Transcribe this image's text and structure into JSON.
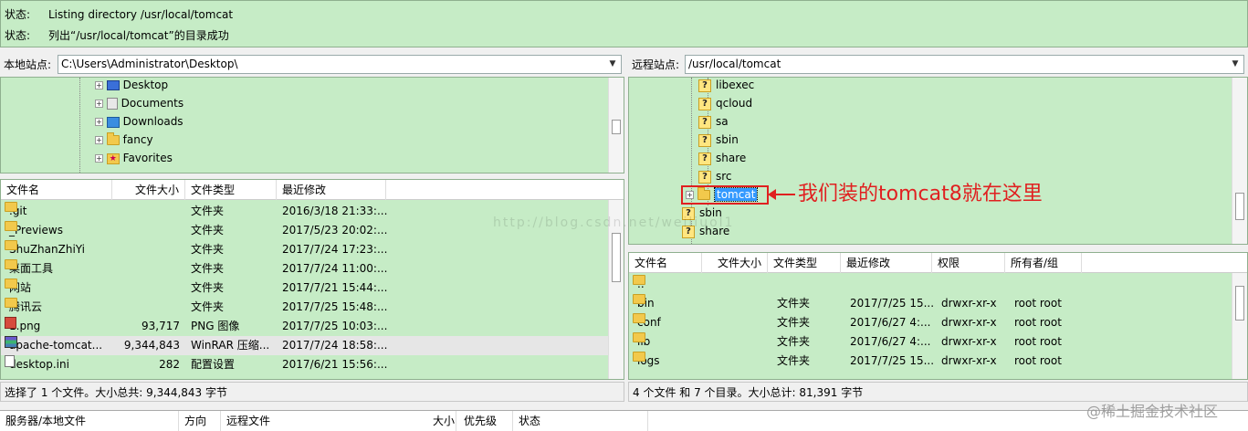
{
  "status_log": [
    {
      "key": "状态:",
      "text": "Listing directory /usr/local/tomcat"
    },
    {
      "key": "状态:",
      "text": "列出“/usr/local/tomcat”的目录成功"
    }
  ],
  "local": {
    "site_label": "本地站点:",
    "path": "C:\\Users\\Administrator\\Desktop\\",
    "tree": [
      {
        "label": "Desktop",
        "icon": "desktop-icon"
      },
      {
        "label": "Documents",
        "icon": "documents-icon"
      },
      {
        "label": "Downloads",
        "icon": "downloads-icon"
      },
      {
        "label": "fancy",
        "icon": "folder-icon"
      },
      {
        "label": "Favorites",
        "icon": "favorites-icon"
      }
    ],
    "columns": [
      "文件名",
      "文件大小",
      "文件类型",
      "最近修改"
    ],
    "files": [
      {
        "name": ".git",
        "size": "",
        "type": "文件夹",
        "modified": "2016/3/18 21:33:...",
        "icon": "folder-icon"
      },
      {
        "name": "_Previews",
        "size": "",
        "type": "文件夹",
        "modified": "2017/5/23 20:02:...",
        "icon": "folder-icon"
      },
      {
        "name": "ShuZhanZhiYi",
        "size": "",
        "type": "文件夹",
        "modified": "2017/7/24 17:23:...",
        "icon": "folder-icon"
      },
      {
        "name": "桌面工具",
        "size": "",
        "type": "文件夹",
        "modified": "2017/7/24 11:00:...",
        "icon": "folder-icon"
      },
      {
        "name": "网站",
        "size": "",
        "type": "文件夹",
        "modified": "2017/7/21 15:44:...",
        "icon": "folder-icon"
      },
      {
        "name": "腾讯云",
        "size": "",
        "type": "文件夹",
        "modified": "2017/7/25 15:48:...",
        "icon": "folder-icon"
      },
      {
        "name": "1.png",
        "size": "93,717",
        "type": "PNG 图像",
        "modified": "2017/7/25 10:03:...",
        "icon": "png-icon"
      },
      {
        "name": "apache-tomcat...",
        "size": "9,344,843",
        "type": "WinRAR 压缩...",
        "modified": "2017/7/24 18:58:...",
        "icon": "rar-icon"
      },
      {
        "name": "desktop.ini",
        "size": "282",
        "type": "配置设置",
        "modified": "2017/6/21 15:56:...",
        "icon": "ini-icon"
      }
    ],
    "status": "选择了 1 个文件。大小总共: 9,344,843 字节"
  },
  "remote": {
    "site_label": "远程站点:",
    "path": "/usr/local/tomcat",
    "tree": [
      {
        "label": "libexec",
        "indent": 2
      },
      {
        "label": "qcloud",
        "indent": 2
      },
      {
        "label": "sa",
        "indent": 2
      },
      {
        "label": "sbin",
        "indent": 2
      },
      {
        "label": "share",
        "indent": 2
      },
      {
        "label": "src",
        "indent": 2
      },
      {
        "label": "tomcat",
        "indent": 2,
        "selected": true
      },
      {
        "label": "sbin",
        "indent": 1
      },
      {
        "label": "share",
        "indent": 1
      }
    ],
    "columns": [
      "文件名",
      "文件大小",
      "文件类型",
      "最近修改",
      "权限",
      "所有者/组"
    ],
    "files": [
      {
        "name": "..",
        "size": "",
        "type": "",
        "modified": "",
        "perm": "",
        "owner": ""
      },
      {
        "name": "bin",
        "size": "",
        "type": "文件夹",
        "modified": "2017/7/25 15...",
        "perm": "drwxr-xr-x",
        "owner": "root root"
      },
      {
        "name": "conf",
        "size": "",
        "type": "文件夹",
        "modified": "2017/6/27 4:...",
        "perm": "drwxr-xr-x",
        "owner": "root root"
      },
      {
        "name": "lib",
        "size": "",
        "type": "文件夹",
        "modified": "2017/6/27 4:...",
        "perm": "drwxr-xr-x",
        "owner": "root root"
      },
      {
        "name": "logs",
        "size": "",
        "type": "文件夹",
        "modified": "2017/7/25 15...",
        "perm": "drwxr-xr-x",
        "owner": "root root"
      }
    ],
    "status": "4 个文件 和 7 个目录。大小总计: 81,391 字节"
  },
  "annotation": "我们装的tomcat8就在这里",
  "watermark": "http://blog.csdn.net/weiliuol1",
  "credit": "@稀土掘金技术社区",
  "queue": {
    "columns": [
      "服务器/本地文件",
      "方向",
      "远程文件",
      "大小",
      "优先级",
      "状态"
    ]
  },
  "colors": {
    "pane_bg": "#c6ecc6",
    "annotation": "#e02020",
    "selection": "#3399ff"
  }
}
